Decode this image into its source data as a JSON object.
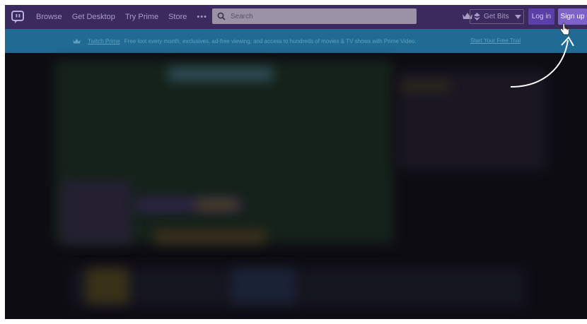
{
  "nav": {
    "links": [
      "Browse",
      "Get Desktop",
      "Try Prime",
      "Store"
    ],
    "more": "•••",
    "search_placeholder": "Search",
    "get_bits": "Get Bits",
    "login": "Log in",
    "signup": "Sign up"
  },
  "banner": {
    "prime_label": "Twitch Prime",
    "message": "Free loot every month, exclusives, ad-free viewing, and access to hundreds of movies & TV shows with Prime Video.",
    "cta": "Start Your Free Trial"
  },
  "colors": {
    "nav_bg": "#3a2a5e",
    "banner_bg": "#1f6b93",
    "login_bg": "#5b3fa8",
    "signup_bg": "#7c62c9",
    "overlay": "#0e0c13"
  }
}
